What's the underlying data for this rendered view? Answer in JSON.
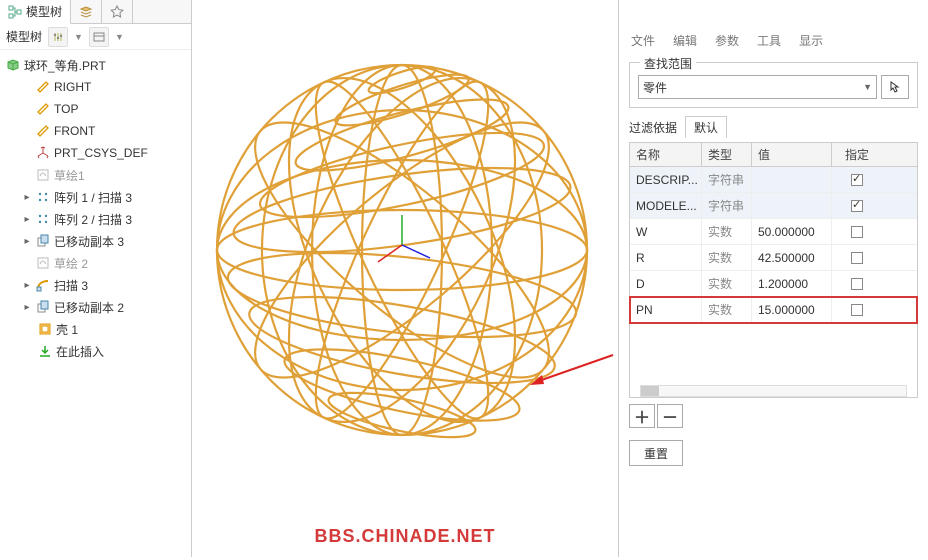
{
  "tabs": {
    "model_tree": "模型树"
  },
  "toolbar": {
    "label": "模型树"
  },
  "tree": {
    "root": "球环_等角.PRT",
    "items": [
      {
        "label": "RIGHT",
        "icon": "plane"
      },
      {
        "label": "TOP",
        "icon": "plane"
      },
      {
        "label": "FRONT",
        "icon": "plane"
      },
      {
        "label": "PRT_CSYS_DEF",
        "icon": "csys"
      },
      {
        "label": "草绘1",
        "icon": "sketch",
        "dim": true
      },
      {
        "label": "阵列 1 / 扫描 3",
        "icon": "pattern",
        "expand": true
      },
      {
        "label": "阵列 2 / 扫描 3",
        "icon": "pattern",
        "expand": true
      },
      {
        "label": "已移动副本 3",
        "icon": "copy",
        "expand": true
      },
      {
        "label": "草绘 2",
        "icon": "sketch",
        "dim": true
      },
      {
        "label": "扫描 3",
        "icon": "sweep",
        "expand": true
      },
      {
        "label": "已移动副本 2",
        "icon": "copy",
        "expand": true
      }
    ],
    "sub": [
      {
        "label": "壳 1",
        "icon": "shell"
      },
      {
        "label": "在此插入",
        "icon": "insert"
      }
    ]
  },
  "menu": {
    "file": "文件",
    "edit": "编辑",
    "params": "参数",
    "tools": "工具",
    "show": "显示"
  },
  "scope": {
    "title": "查找范围",
    "value": "零件"
  },
  "filter": {
    "label": "过滤依据",
    "tab": "默认"
  },
  "table": {
    "head": {
      "name": "名称",
      "type": "类型",
      "value": "值",
      "spec": "指定"
    },
    "rows": [
      {
        "name": "DESCRIP...",
        "type": "字符串",
        "value": "",
        "chk": true,
        "hl": true
      },
      {
        "name": "MODELE...",
        "type": "字符串",
        "value": "",
        "chk": true,
        "hl": true
      },
      {
        "name": "W",
        "type": "实数",
        "value": "50.000000",
        "chk": false
      },
      {
        "name": "R",
        "type": "实数",
        "value": "42.500000",
        "chk": false
      },
      {
        "name": "D",
        "type": "实数",
        "value": "1.200000",
        "chk": false
      },
      {
        "name": "PN",
        "type": "实数",
        "value": "15.000000",
        "chk": false,
        "red": true
      }
    ]
  },
  "buttons": {
    "add": "＋",
    "remove": "－",
    "reset": "重置"
  },
  "watermark": "BBS.CHINADE.NET"
}
